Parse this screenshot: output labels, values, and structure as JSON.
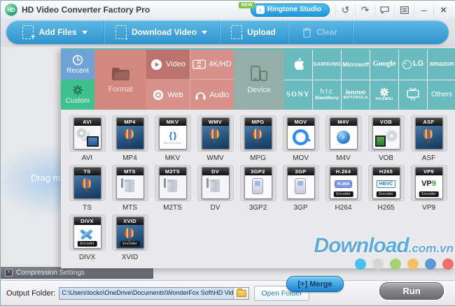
{
  "window": {
    "title": "HD Video Converter Factory Pro",
    "logo_text": "HD",
    "new_badge": "NEW",
    "ringtone_button": "Ringtone Studio",
    "undo_glyph": "↺",
    "share_glyph": "↷",
    "minimize_glyph": "–",
    "close_glyph": "×"
  },
  "toolbar": {
    "add_files": "Add Files",
    "download_video": "Download Video",
    "upload": "Upload",
    "clear": "Clear"
  },
  "drop_area": {
    "visible_hint": "Drag m"
  },
  "panel": {
    "tabs": {
      "recent": "Recent",
      "custom": "Custom",
      "format": "Format",
      "video": "Video",
      "web": "Web",
      "fourk": "4K/HD",
      "audio": "Audio",
      "device": "Device"
    },
    "brands": [
      {
        "name": "Apple"
      },
      {
        "l1": "SAMSUNG"
      },
      {
        "l1": "Microsoft"
      },
      {
        "l1": "Google"
      },
      {
        "l1": "LG"
      },
      {
        "l1": "amazon"
      },
      {
        "l1": "SONY"
      },
      {
        "l1": "htc",
        "l2": "BlackBerry"
      },
      {
        "l1": "lenovo",
        "l2": "MOTOROLA"
      },
      {
        "l1": "HUAWEI"
      },
      {
        "l1": "TV"
      },
      {
        "l1": "Others"
      }
    ],
    "formats": [
      {
        "head": "AVI",
        "label": "AVI"
      },
      {
        "head": "MP4",
        "label": "MP4"
      },
      {
        "head": "MKV",
        "label": "MKV",
        "sub": "MATROSKA"
      },
      {
        "head": "WMV",
        "label": "WMV"
      },
      {
        "head": "MPG",
        "label": "MPG"
      },
      {
        "head": "MOV",
        "label": "MOV"
      },
      {
        "head": "M4V",
        "label": "M4V"
      },
      {
        "head": "VOB",
        "label": "VOB"
      },
      {
        "head": "ASF",
        "label": "ASF"
      },
      {
        "head": "TS",
        "label": "TS"
      },
      {
        "head": "MTS",
        "label": "MTS"
      },
      {
        "head": "M2TS",
        "label": "M2TS"
      },
      {
        "head": "DV",
        "label": "DV"
      },
      {
        "head": "3GP2",
        "label": "3GP2"
      },
      {
        "head": "3GP",
        "label": "3GP"
      },
      {
        "head": "H.264",
        "label": "H264",
        "badge": "H.264",
        "encoder": "Encoder"
      },
      {
        "head": "H265",
        "label": "H265",
        "badge": "HEVC",
        "encoder": "Encoder"
      },
      {
        "head": "VP9",
        "label": "VP9",
        "badge": "VP",
        "badge_accent": "9",
        "encoder": "Encoder"
      },
      {
        "head": "DIVX",
        "label": "DIVX",
        "encoder": "Encoder"
      },
      {
        "head": "XVID",
        "label": "XVID",
        "encoder": "Encoder"
      }
    ]
  },
  "footer": {
    "compression_settings": "Compression Settings",
    "output_folder_label": "Output Folder:",
    "output_path": "C:\\Users\\locko\\OneDrive\\Documents\\WonderFox Soft\\HD Video Converter F",
    "open_folder": "Open Folder",
    "merge": "[+] Merge",
    "run": "Run"
  },
  "watermark": {
    "main": "Download",
    "suffix": ".com.vn",
    "dots": [
      "#49c0ef",
      "#d6d6d6",
      "#a5d373",
      "#f3c063",
      "#5b9bd5",
      "#ef6f6c"
    ]
  }
}
